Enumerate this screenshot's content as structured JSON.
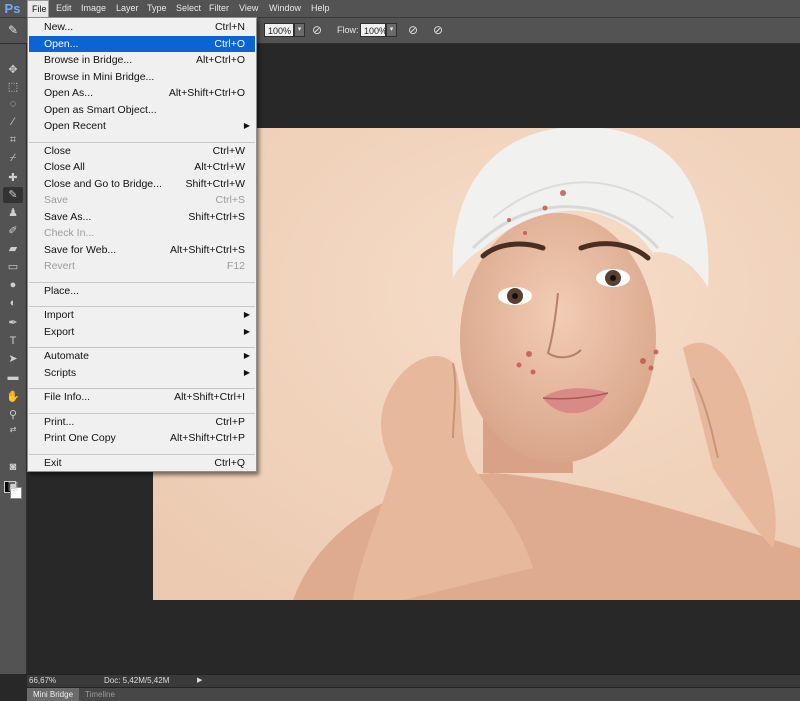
{
  "app": {
    "logo": "Ps"
  },
  "menubar": {
    "items": [
      "File",
      "Edit",
      "Image",
      "Layer",
      "Type",
      "Select",
      "Filter",
      "View",
      "Window",
      "Help"
    ]
  },
  "options": {
    "opacity_value": "100%",
    "flow_label": "Flow:",
    "flow_value": "100%"
  },
  "file_menu": {
    "groups": [
      [
        {
          "label": "New...",
          "shortcut": "Ctrl+N"
        },
        {
          "label": "Open...",
          "shortcut": "Ctrl+O",
          "highlighted": true
        },
        {
          "label": "Browse in Bridge...",
          "shortcut": "Alt+Ctrl+O"
        },
        {
          "label": "Browse in Mini Bridge...",
          "shortcut": ""
        },
        {
          "label": "Open As...",
          "shortcut": "Alt+Shift+Ctrl+O"
        },
        {
          "label": "Open as Smart Object...",
          "shortcut": ""
        },
        {
          "label": "Open Recent",
          "shortcut": "",
          "submenu": true
        }
      ],
      [
        {
          "label": "Close",
          "shortcut": "Ctrl+W"
        },
        {
          "label": "Close All",
          "shortcut": "Alt+Ctrl+W"
        },
        {
          "label": "Close and Go to Bridge...",
          "shortcut": "Shift+Ctrl+W"
        },
        {
          "label": "Save",
          "shortcut": "Ctrl+S",
          "disabled": true
        },
        {
          "label": "Save As...",
          "shortcut": "Shift+Ctrl+S"
        },
        {
          "label": "Check In...",
          "shortcut": "",
          "disabled": true
        },
        {
          "label": "Save for Web...",
          "shortcut": "Alt+Shift+Ctrl+S"
        },
        {
          "label": "Revert",
          "shortcut": "F12",
          "disabled": true
        }
      ],
      [
        {
          "label": "Place...",
          "shortcut": ""
        }
      ],
      [
        {
          "label": "Import",
          "shortcut": "",
          "submenu": true
        },
        {
          "label": "Export",
          "shortcut": "",
          "submenu": true
        }
      ],
      [
        {
          "label": "Automate",
          "shortcut": "",
          "submenu": true
        },
        {
          "label": "Scripts",
          "shortcut": "",
          "submenu": true
        }
      ],
      [
        {
          "label": "File Info...",
          "shortcut": "Alt+Shift+Ctrl+I"
        }
      ],
      [
        {
          "label": "Print...",
          "shortcut": "Ctrl+P"
        },
        {
          "label": "Print One Copy",
          "shortcut": "Alt+Shift+Ctrl+P"
        }
      ],
      [
        {
          "label": "Exit",
          "shortcut": "Ctrl+Q"
        }
      ]
    ]
  },
  "toolbar": {
    "tools": [
      "move-icon",
      "marquee-icon",
      "lasso-icon",
      "quick-select-icon",
      "crop-icon",
      "eyedropper-icon",
      "healing-brush-icon",
      "brush-icon",
      "clone-stamp-icon",
      "history-brush-icon",
      "eraser-icon",
      "gradient-icon",
      "blur-icon",
      "dodge-icon",
      "pen-icon",
      "type-icon",
      "path-select-icon",
      "rectangle-icon",
      "hand-icon",
      "zoom-icon"
    ],
    "selected_tool": "brush-icon"
  },
  "status": {
    "zoom": "66,67%",
    "doc_info": "Doc: 5,42M/5,42M"
  },
  "bottom_tabs": [
    "Mini Bridge",
    "Timeline"
  ]
}
